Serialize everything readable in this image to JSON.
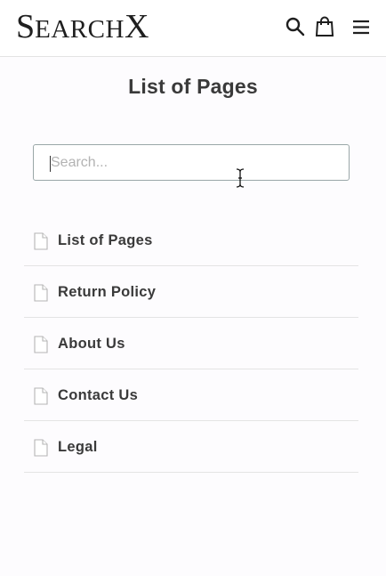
{
  "header": {
    "logo_text": "SearchX",
    "icons": [
      "search-icon",
      "shopping-bag-icon",
      "hamburger-menu-icon"
    ]
  },
  "main": {
    "title": "List of Pages",
    "search": {
      "placeholder": "Search...",
      "value": ""
    },
    "pages": [
      {
        "label": "List of Pages",
        "icon": "document-icon"
      },
      {
        "label": "Return Policy",
        "icon": "document-icon"
      },
      {
        "label": "About Us",
        "icon": "document-icon"
      },
      {
        "label": "Contact Us",
        "icon": "document-icon"
      },
      {
        "label": "Legal",
        "icon": "document-icon"
      }
    ]
  },
  "colors": {
    "background": "#fdfcfe",
    "header_background": "#ffffff",
    "text": "#3a3a3a",
    "input_border": "#9aa7a8",
    "divider": "#e4e4e4"
  }
}
